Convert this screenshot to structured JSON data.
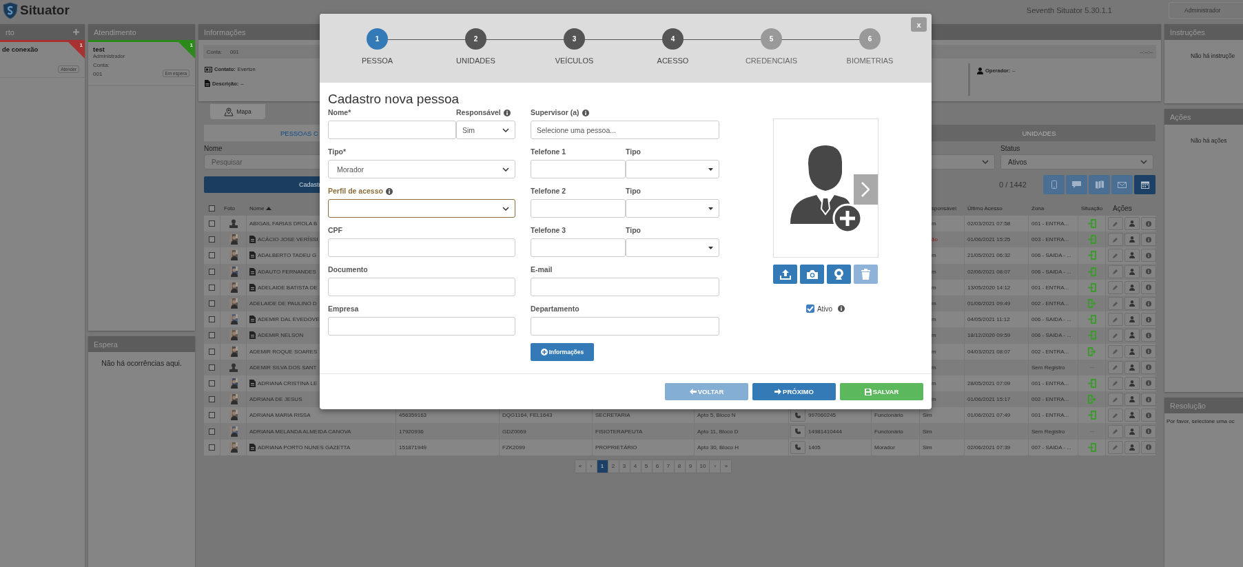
{
  "app": {
    "logo": "Situator",
    "version": "Seventh Situator 5.30.1.1",
    "user": "Administrador"
  },
  "queue_panel": {
    "title": "rto",
    "card": {
      "title": "de conexão",
      "badge": "1",
      "color": "#a83232",
      "button": "Atender"
    }
  },
  "attendance_panel": {
    "title": "Atendimento",
    "card": {
      "title": "test",
      "subtitle": "Administrador",
      "account_label": "Conta:",
      "account": "001",
      "badge": "1",
      "color": "#2b8a1a",
      "button": "Em espera"
    }
  },
  "waiting_panel": {
    "title": "Espera",
    "empty": "Não há ocorrências aqui."
  },
  "info_panel": {
    "title": "Informações",
    "account_label": "Conta:",
    "account": "001",
    "time": "--:--:--",
    "contact_label": "Contato:",
    "contact": "Everton",
    "description_label": "Descrição:",
    "description": "–",
    "operator_label": "Operador:",
    "operator": "–"
  },
  "map_button": "Mapa",
  "tabs": [
    {
      "label": "PESSOAS C",
      "selected": true
    },
    {
      "label": "UNIDADES",
      "selected": false
    }
  ],
  "filters": {
    "name_label": "Nome",
    "name_placeholder": "Pesquisar",
    "status_label": "Status",
    "status_value": "Ativos"
  },
  "register_button": "Cadastr",
  "count": "0 / 1442",
  "toolbar_buttons": [
    {
      "selected": false
    },
    {
      "selected": false
    },
    {
      "selected": false
    },
    {
      "selected": false
    },
    {
      "selected": true
    }
  ],
  "table": {
    "header_checked": false,
    "columns": [
      {
        "label": "Foto",
        "sorted": false
      },
      {
        "label": "Nome",
        "sorted": true
      },
      {
        "label": "sponsável",
        "sorted": false
      },
      {
        "label": "Último Acesso",
        "sorted": false
      },
      {
        "label": "Zona",
        "sorted": false
      },
      {
        "label": "Situação",
        "sorted": false
      },
      {
        "label": "Ações",
        "sorted": false
      }
    ],
    "rows": [
      {
        "checked": false,
        "has_photo": false,
        "document": false,
        "name": "ABIGAIL FARIAS DROLA B",
        "responsible": "m",
        "alert": false,
        "last_access": "02/03/2021 07:58",
        "zone": "001 - ENTRA...",
        "kind": "in"
      },
      {
        "checked": false,
        "has_photo": true,
        "document": true,
        "name": "ACÁCIO JOSE VERÍSSI",
        "responsible": "ão",
        "alert": true,
        "last_access": "01/06/2021 15:25",
        "zone": "003 - ENTRA...",
        "kind": "in"
      },
      {
        "checked": false,
        "has_photo": true,
        "document": true,
        "name": "ADALBERTO TADEU G",
        "responsible": "m",
        "alert": false,
        "last_access": "21/05/2021 06:32",
        "zone": "006 - SAIDA - ...",
        "kind": "in"
      },
      {
        "checked": false,
        "has_photo": true,
        "document": true,
        "name": "ADAUTO FERNANDES",
        "responsible": "m",
        "alert": false,
        "last_access": "02/06/2021 08:07",
        "zone": "006 - SAIDA - ...",
        "kind": "in"
      },
      {
        "checked": false,
        "has_photo": true,
        "document": true,
        "name": "ADELAIDE BATISTA DE",
        "responsible": "m",
        "alert": false,
        "last_access": "13/05/2020 14:12",
        "zone": "001 - ENTRA...",
        "kind": "in"
      },
      {
        "checked": false,
        "has_photo": true,
        "document": false,
        "name": "ADELAIDE DE PAULINO D",
        "responsible": "m",
        "alert": false,
        "last_access": "01/06/2021 09:49",
        "zone": "002 - ENTRA...",
        "kind": "out"
      },
      {
        "checked": false,
        "has_photo": true,
        "document": true,
        "name": "ADEMIR DAL EVEDOVE",
        "responsible": "m",
        "alert": false,
        "last_access": "04/05/2021 11:12",
        "zone": "006 - SAIDA - ...",
        "kind": "in"
      },
      {
        "checked": false,
        "has_photo": true,
        "document": true,
        "name": "ADEMIR NELSON",
        "responsible": "m",
        "alert": false,
        "last_access": "18/12/2020 09:59",
        "zone": "006 - SAIDA - ...",
        "kind": "in"
      },
      {
        "checked": false,
        "has_photo": true,
        "document": false,
        "name": "ADEMIR ROQUE SOARES",
        "responsible": "m",
        "alert": false,
        "last_access": "04/03/2021 08:07",
        "zone": "002 - ENTRA...",
        "kind": "out"
      },
      {
        "checked": false,
        "has_photo": false,
        "document": false,
        "name": "ADEMIR SILVA DOS SANT",
        "responsible": "m",
        "alert": false,
        "zone": "Sem Registro",
        "kind": "none"
      },
      {
        "checked": false,
        "has_photo": true,
        "document": true,
        "name": "ADRIANA CRISTINA LE",
        "responsible": "m",
        "alert": false,
        "last_access": "28/05/2021 07:09",
        "zone": "001 - ENTRA...",
        "kind": "in"
      },
      {
        "checked": false,
        "has_photo": true,
        "document": false,
        "name": "ADRIANA DE JESUS",
        "responsible": "m",
        "alert": false,
        "last_access": "01/06/2021 15:17",
        "zone": "002 - ENTRA...",
        "kind": "out"
      },
      {
        "checked": false,
        "has_photo": true,
        "document": false,
        "name": "ADRIANA MARIA RISSA",
        "details": {
          "document_number": "456359163",
          "plates": "DQG1164, FEL1643",
          "occupation": "SECRETARIA",
          "unit": "Apto 5, Bloco N",
          "phone": "997060245",
          "person_type": "Funcionário"
        },
        "responsible": "Sim",
        "alert": false,
        "last_access": "01/06/2021 07:49",
        "zone": "001 - ENTRA...",
        "kind": "in"
      },
      {
        "checked": false,
        "has_photo": true,
        "document": false,
        "name": "ADRIANA MELANDA ALMEIDA CANOVA",
        "details": {
          "document_number": "17920936",
          "plates": "GDZ0069",
          "occupation": "FISIOTERAPEUTA",
          "unit": "Apto 11, Bloco D",
          "phone": "14981410444",
          "person_type": "Funcionário"
        },
        "responsible": "Sim",
        "alert": false,
        "zone": "Sem Registro",
        "kind": "none"
      },
      {
        "checked": false,
        "has_photo": true,
        "document": true,
        "name": "ADRIANA PORTO NUNES GAZETTA",
        "details": {
          "document_number": "151871949",
          "plates": "FZK2099",
          "occupation": "PROPRIETÁRIO",
          "unit": "Apto 30, Bloco H",
          "phone": "1405",
          "person_type": "Morador"
        },
        "responsible": "Sim",
        "alert": false,
        "last_access": "02/06/2021 07:39",
        "zone": "007 - SAIDA - ...",
        "kind": "in"
      }
    ]
  },
  "pagination": [
    {
      "label": "«",
      "selected": false
    },
    {
      "label": "‹",
      "selected": false
    },
    {
      "label": "1",
      "selected": true
    },
    {
      "label": "2",
      "selected": false
    },
    {
      "label": "3",
      "selected": false
    },
    {
      "label": "4",
      "selected": false
    },
    {
      "label": "5",
      "selected": false
    },
    {
      "label": "6",
      "selected": false
    },
    {
      "label": "7",
      "selected": false
    },
    {
      "label": "8",
      "selected": false
    },
    {
      "label": "9",
      "selected": false
    },
    {
      "label": "10",
      "selected": false
    },
    {
      "label": "›",
      "selected": false
    },
    {
      "label": "»",
      "selected": false
    }
  ],
  "instructions_panel": {
    "title": "Instruções",
    "empty": "Não há instruçõe"
  },
  "actions_panel": {
    "title": "Ações",
    "empty": "Não há ações"
  },
  "resolution_panel": {
    "title": "Resolução",
    "text": "Por favor, selecione uma oc"
  },
  "modal": {
    "close": "x",
    "steps": [
      {
        "number": "1",
        "label": "PESSOA",
        "selected": true,
        "disabled": false
      },
      {
        "number": "2",
        "label": "UNIDADES",
        "selected": false,
        "disabled": false
      },
      {
        "number": "3",
        "label": "VEÍCULOS",
        "selected": false,
        "disabled": false
      },
      {
        "number": "4",
        "label": "ACESSO",
        "selected": false,
        "disabled": false
      },
      {
        "number": "5",
        "label": "CREDENCIAIS",
        "selected": false,
        "disabled": true
      },
      {
        "number": "6",
        "label": "BIOMETRIAS",
        "selected": false,
        "disabled": true
      }
    ],
    "title": "Cadastro nova pessoa",
    "name": {
      "label": "Nome*"
    },
    "responsible": {
      "label": "Responsável",
      "value": "Sim"
    },
    "supervisor": {
      "label": "Supervisor (a)",
      "placeholder": "Selecione uma pessoa..."
    },
    "type": {
      "label": "Tipo*",
      "value": "Morador"
    },
    "access_profile": {
      "label": "Perfil de acesso",
      "highlighted": true
    },
    "phones": [
      {
        "label": "Telefone 1",
        "type_label": "Tipo"
      },
      {
        "label": "Telefone 2",
        "type_label": "Tipo"
      },
      {
        "label": "Telefone 3",
        "type_label": "Tipo"
      }
    ],
    "cpf": {
      "label": "CPF"
    },
    "document": {
      "label": "Documento"
    },
    "email": {
      "label": "E-mail"
    },
    "company": {
      "label": "Empresa"
    },
    "department": {
      "label": "Departamento"
    },
    "info_button": "Informações",
    "photo_buttons": [
      {
        "disabled": false
      },
      {
        "disabled": false
      },
      {
        "disabled": false
      },
      {
        "disabled": true
      }
    ],
    "active": {
      "label": "Ativo",
      "checked": true
    },
    "footer_buttons": [
      {
        "kind": "back",
        "label": "VOLTAR",
        "disabled": true
      },
      {
        "kind": "next",
        "label": "PRÓXIMO",
        "disabled": false
      },
      {
        "kind": "save",
        "label": "SALVAR",
        "disabled": false
      }
    ]
  }
}
